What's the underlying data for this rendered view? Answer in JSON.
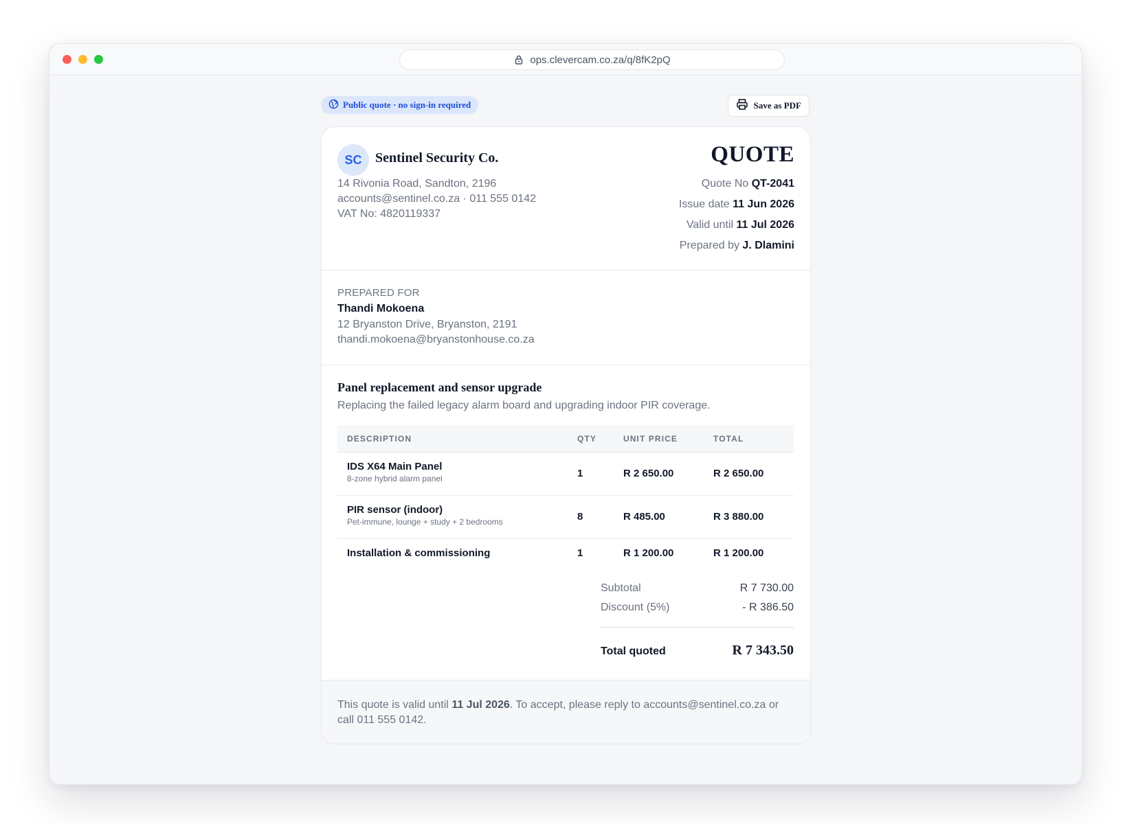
{
  "browser": {
    "url": "ops.clevercam.co.za/q/8fK2pQ"
  },
  "topbar": {
    "public_badge": "Public quote · no sign-in required",
    "save_pdf_label": "Save as PDF"
  },
  "company": {
    "initials": "SC",
    "name": "Sentinel Security Co.",
    "address": "14 Rivonia Road, Sandton, 2196",
    "contact": "accounts@sentinel.co.za · 011 555 0142",
    "vat": "VAT No: 4820119337"
  },
  "quote": {
    "heading": "QUOTE",
    "meta": [
      {
        "label": "Quote No",
        "value": "QT-2041"
      },
      {
        "label": "Issue date",
        "value": "11 Jun 2026"
      },
      {
        "label": "Valid until",
        "value": "11 Jul 2026"
      },
      {
        "label": "Prepared by",
        "value": "J. Dlamini"
      }
    ]
  },
  "client": {
    "label": "PREPARED FOR",
    "name": "Thandi Mokoena",
    "address": "12 Bryanston Drive, Bryanston, 2191",
    "email": "thandi.mokoena@bryanstonhouse.co.za"
  },
  "job": {
    "title": "Panel replacement and sensor upgrade",
    "description": "Replacing the failed legacy alarm board and upgrading indoor PIR coverage."
  },
  "table": {
    "headers": {
      "description": "DESCRIPTION",
      "qty": "QTY",
      "unit_price": "UNIT PRICE",
      "total": "TOTAL"
    },
    "rows": [
      {
        "name": "IDS X64 Main Panel",
        "sub": "8-zone hybrid alarm panel",
        "qty": "1",
        "unit_price": "R 2 650.00",
        "total": "R 2 650.00"
      },
      {
        "name": "PIR sensor (indoor)",
        "sub": "Pet-immune, lounge + study + 2 bedrooms",
        "qty": "8",
        "unit_price": "R 485.00",
        "total": "R 3 880.00"
      },
      {
        "name": "Installation & commissioning",
        "sub": "",
        "qty": "1",
        "unit_price": "R 1 200.00",
        "total": "R 1 200.00"
      }
    ]
  },
  "totals": {
    "subtotal_label": "Subtotal",
    "subtotal": "R 7 730.00",
    "discount_label": "Discount (5%)",
    "discount": "- R 386.50",
    "grand_label": "Total quoted",
    "grand": "R 7 343.50"
  },
  "footer": {
    "text_before": "This quote is valid until ",
    "valid_date": "11 Jul 2026",
    "text_after": ". To accept, please reply to accounts@sentinel.co.za or call 011 555 0142."
  },
  "colors": {
    "accent": "#2563eb",
    "badge_bg": "#dbe6fb",
    "text_primary": "#111827",
    "text_muted": "#6b7280"
  },
  "icons": {
    "lock": "lock-icon",
    "globe": "globe-icon",
    "printer": "printer-icon"
  }
}
